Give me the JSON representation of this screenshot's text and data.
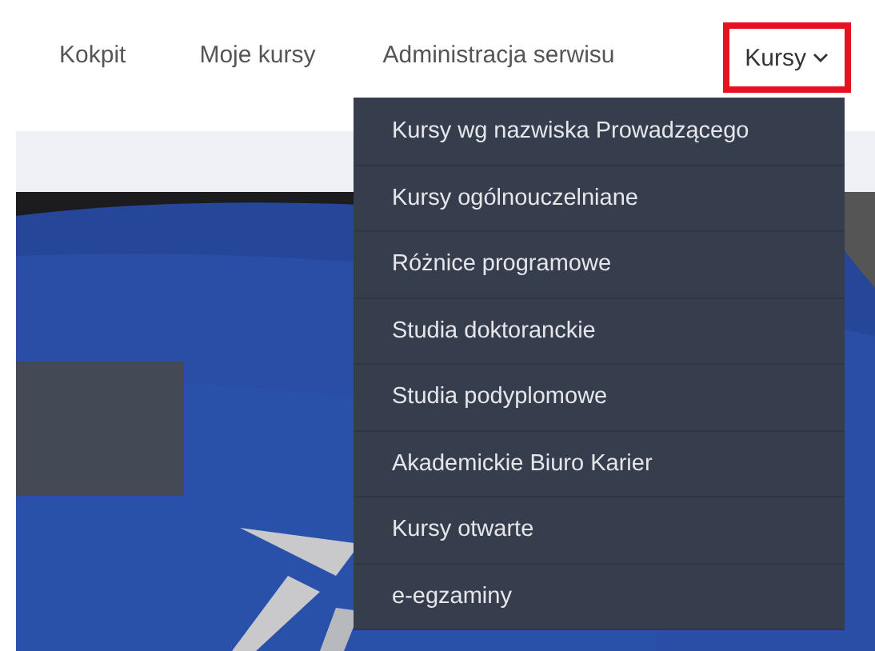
{
  "nav": {
    "items": [
      {
        "label": "Kokpit",
        "kind": "link"
      },
      {
        "label": "Moje kursy",
        "kind": "link"
      },
      {
        "label": "Administracja serwisu",
        "kind": "link"
      },
      {
        "label": "Kursy",
        "kind": "dropdown",
        "expanded": true,
        "highlighted": true
      }
    ]
  },
  "dropdown_menu": {
    "items": [
      {
        "label": "Kursy wg nazwiska Prowadzącego"
      },
      {
        "label": "Kursy ogólnouczelniane"
      },
      {
        "label": "Różnice programowe"
      },
      {
        "label": "Studia doktoranckie"
      },
      {
        "label": "Studia podyplomowe"
      },
      {
        "label": "Akademickie Biuro Karier"
      },
      {
        "label": "Kursy otwarte"
      },
      {
        "label": "e-egzaminy"
      }
    ]
  }
}
